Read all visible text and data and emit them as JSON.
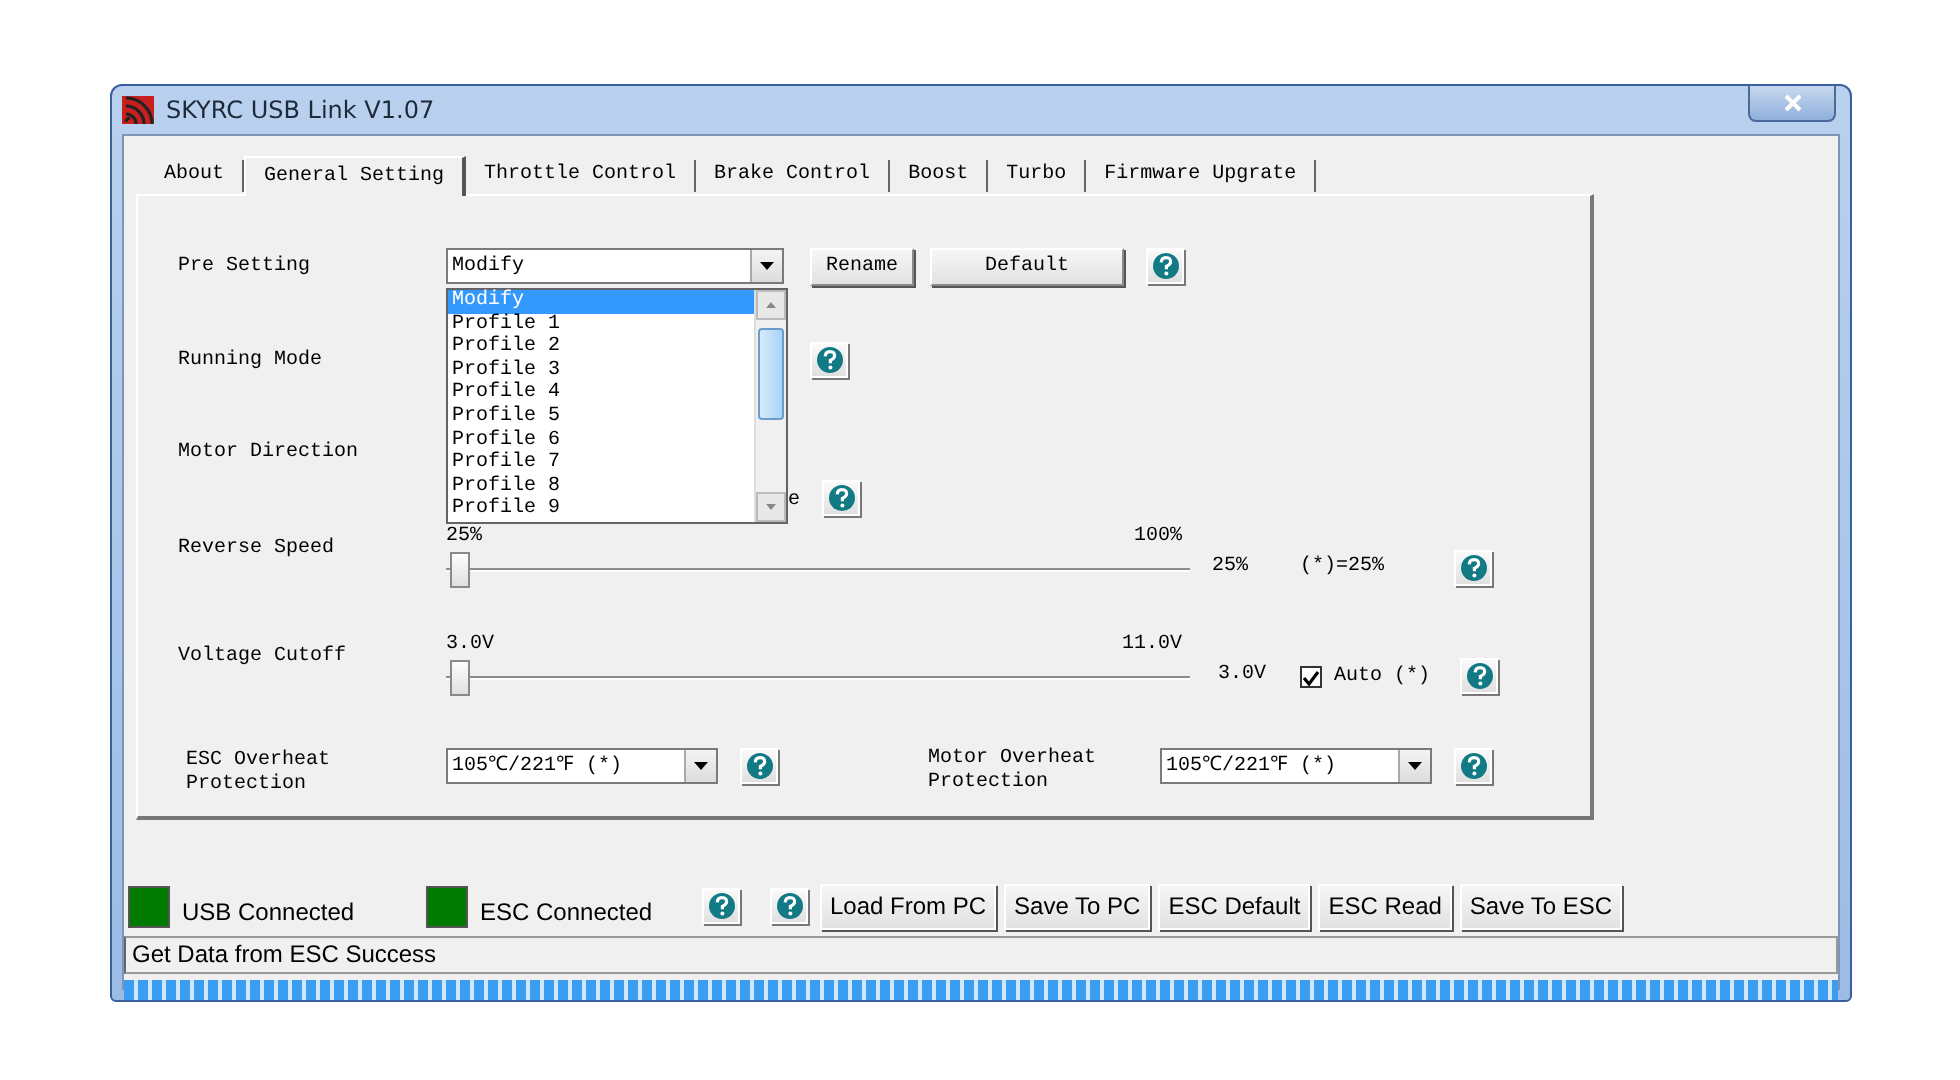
{
  "window": {
    "title": "SKYRC USB Link V1.07"
  },
  "tabs": [
    {
      "label": "About",
      "selected": false
    },
    {
      "label": "General Setting",
      "selected": true
    },
    {
      "label": "Throttle Control",
      "selected": false
    },
    {
      "label": "Brake Control",
      "selected": false
    },
    {
      "label": "Boost",
      "selected": false
    },
    {
      "label": "Turbo",
      "selected": false
    },
    {
      "label": "Firmware Upgrate",
      "selected": false
    }
  ],
  "pre_setting": {
    "label": "Pre Setting",
    "value": "Modify",
    "buttons": [
      "Rename",
      "Default"
    ],
    "dropdown": [
      {
        "label": "Modify",
        "selected": true
      },
      {
        "label": "Profile 1",
        "selected": false
      },
      {
        "label": "Profile 2",
        "selected": false
      },
      {
        "label": "Profile 3",
        "selected": false
      },
      {
        "label": "Profile 4",
        "selected": false
      },
      {
        "label": "Profile 5",
        "selected": false
      },
      {
        "label": "Profile 6",
        "selected": false
      },
      {
        "label": "Profile 7",
        "selected": false
      },
      {
        "label": "Profile 8",
        "selected": false
      },
      {
        "label": "Profile 9",
        "selected": false
      }
    ]
  },
  "running_mode": {
    "label": "Running Mode"
  },
  "motor_direction": {
    "label": "Motor Direction",
    "fragment": "e"
  },
  "reverse_speed": {
    "label": "Reverse Speed",
    "min": "25%",
    "max": "100%",
    "level": 0,
    "reading": "25%",
    "note": "(*)=25%"
  },
  "voltage_cutoff": {
    "label": "Voltage Cutoff",
    "min": "3.0V",
    "max": "11.0V",
    "level": 0,
    "reading": "3.0V",
    "auto": {
      "label": "Auto (*)",
      "checked": true
    }
  },
  "overheat": [
    {
      "label": "ESC Overheat Protection",
      "value": "105℃/221℉ (*)"
    },
    {
      "label": "Motor Overheat Protection",
      "value": "105℃/221℉ (*)"
    }
  ],
  "indicators": [
    {
      "label": "USB Connected",
      "on": true
    },
    {
      "label": "ESC Connected",
      "on": true
    }
  ],
  "buttons": [
    "Load From PC",
    "Save To PC",
    "ESC Default",
    "ESC Read",
    "Save To ESC"
  ],
  "status_bar": "Get Data from ESC Success",
  "progress": {
    "level": 1
  }
}
